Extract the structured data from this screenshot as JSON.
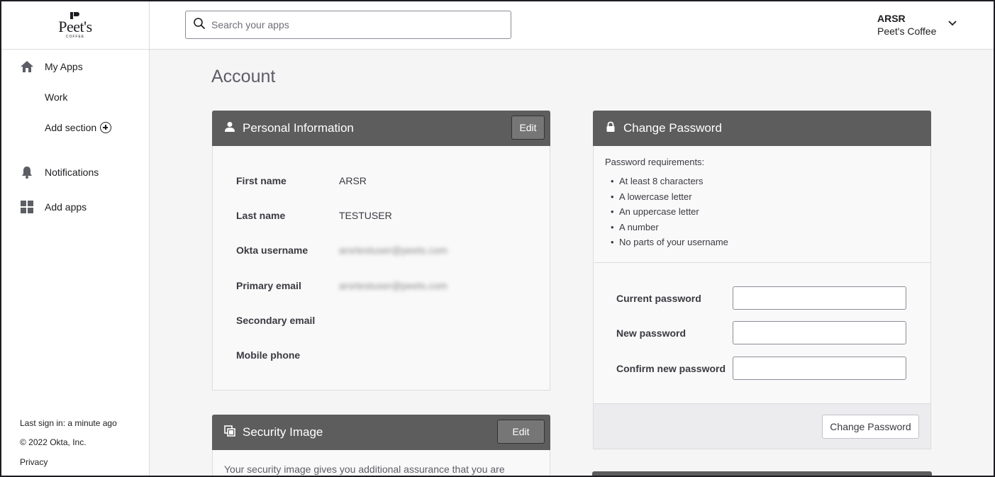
{
  "brand": {
    "logo_text": "Peet's",
    "logo_subtext": "COFFEE"
  },
  "search": {
    "placeholder": "Search your apps"
  },
  "user": {
    "name": "ARSR",
    "org": "Peet's Coffee"
  },
  "sidebar": {
    "items": [
      {
        "label": "My Apps",
        "icon": "home-icon"
      },
      {
        "label": "Work"
      },
      {
        "label": "Add section",
        "icon": "plus-circle-icon"
      },
      {
        "label": "Notifications",
        "icon": "bell-icon"
      },
      {
        "label": "Add apps",
        "icon": "grid-icon"
      }
    ],
    "footer": {
      "last_sign_in": "Last sign in: a minute ago",
      "copyright": "© 2022 Okta, Inc.",
      "privacy": "Privacy"
    }
  },
  "page": {
    "title": "Account"
  },
  "personal_info": {
    "title": "Personal Information",
    "edit_label": "Edit",
    "fields": [
      {
        "label": "First name",
        "value": "ARSR"
      },
      {
        "label": "Last name",
        "value": "TESTUSER"
      },
      {
        "label": "Okta username",
        "value": "arsrtestuser@peets.com",
        "redacted": true
      },
      {
        "label": "Primary email",
        "value": "arsrtestuser@peets.com",
        "redacted": true
      },
      {
        "label": "Secondary email",
        "value": ""
      },
      {
        "label": "Mobile phone",
        "value": ""
      }
    ]
  },
  "security_image": {
    "title": "Security Image",
    "edit_label": "Edit",
    "description": "Your security image gives you additional assurance that you are"
  },
  "change_password": {
    "title": "Change Password",
    "requirements_heading": "Password requirements:",
    "requirements": [
      "At least 8 characters",
      "A lowercase letter",
      "An uppercase letter",
      "A number",
      "No parts of your username"
    ],
    "current_label": "Current password",
    "new_label": "New password",
    "confirm_label": "Confirm new password",
    "button_label": "Change Password"
  },
  "colors": {
    "card_header": "#5d5d5d",
    "page_bg": "#f5f5f6",
    "text": "#1d1d21"
  }
}
